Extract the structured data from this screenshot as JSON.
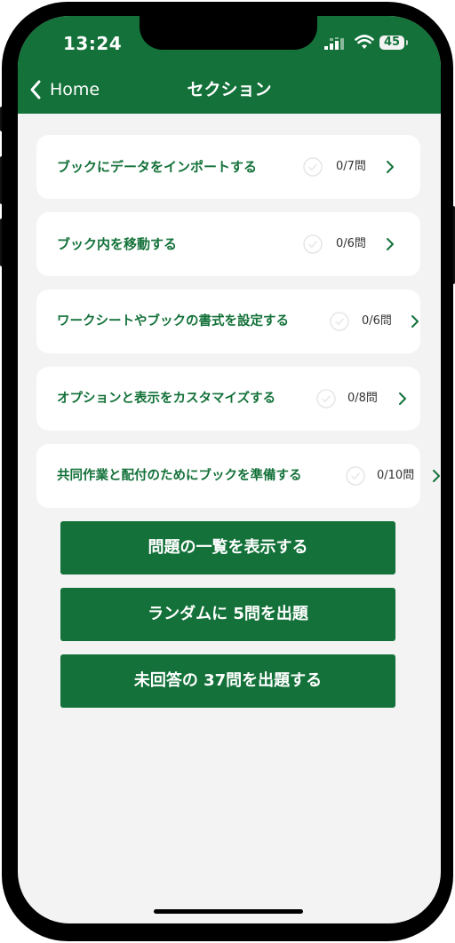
{
  "status_bar": {
    "time": "13:24",
    "battery": "45"
  },
  "header": {
    "back_label": "Home",
    "title": "セクション"
  },
  "sections": [
    {
      "label": "ブックにデータをインポートする",
      "count": "0/7問"
    },
    {
      "label": "ブック内を移動する",
      "count": "0/6問"
    },
    {
      "label": "ワークシートやブックの書式を設定する",
      "count": "0/6問"
    },
    {
      "label": "オプションと表示をカスタマイズする",
      "count": "0/8問"
    },
    {
      "label": "共同作業と配付のためにブックを準備する",
      "count": "0/10問"
    }
  ],
  "buttons": {
    "list_label": "問題の一覧を表示する",
    "random_label": "ランダムに 5問を出題",
    "unanswered_label": "未回答の 37問を出題する"
  },
  "colors": {
    "primary": "#137139",
    "background": "#f3f3f3",
    "card": "#ffffff"
  }
}
